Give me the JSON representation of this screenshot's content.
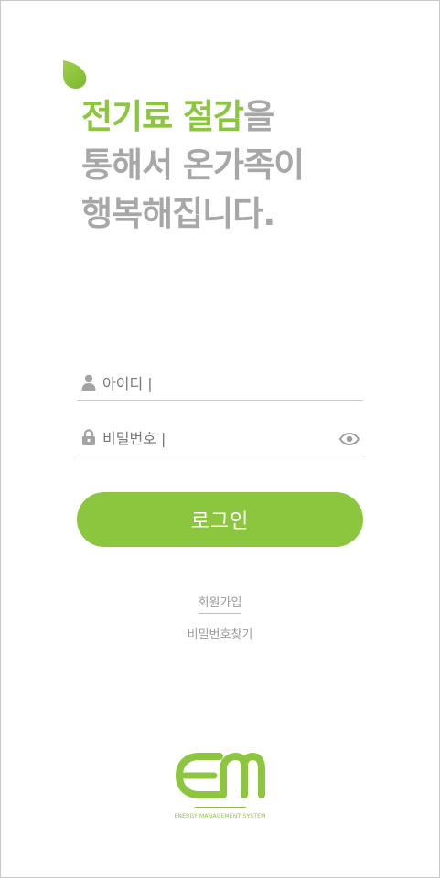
{
  "colors": {
    "accent": "#8cc63f",
    "headline_gray": "#a7a7a7",
    "text_gray": "#777777",
    "divider": "#cfcfcf",
    "background": "#ffffff"
  },
  "headline": {
    "line1_accent": "전기료 절감",
    "line1_rest": "을",
    "line2": "통해서 온가족이",
    "line3": "행복해집니다."
  },
  "login_form": {
    "id_field": {
      "icon": "user-icon",
      "placeholder": "아이디 |",
      "value": ""
    },
    "password_field": {
      "icon": "lock-icon",
      "placeholder": "비밀번호 |",
      "value": "",
      "toggle_icon": "eye-icon"
    },
    "login_label": "로그인"
  },
  "links": {
    "signup": "회원가입",
    "find_password": "비밀번호찾기"
  },
  "brand": {
    "logo_icon": "em-logo-icon",
    "tagline": "ENERGY MANAGEMENT SYSTEM"
  },
  "decoration": {
    "leaf_icon": "leaf-icon"
  }
}
